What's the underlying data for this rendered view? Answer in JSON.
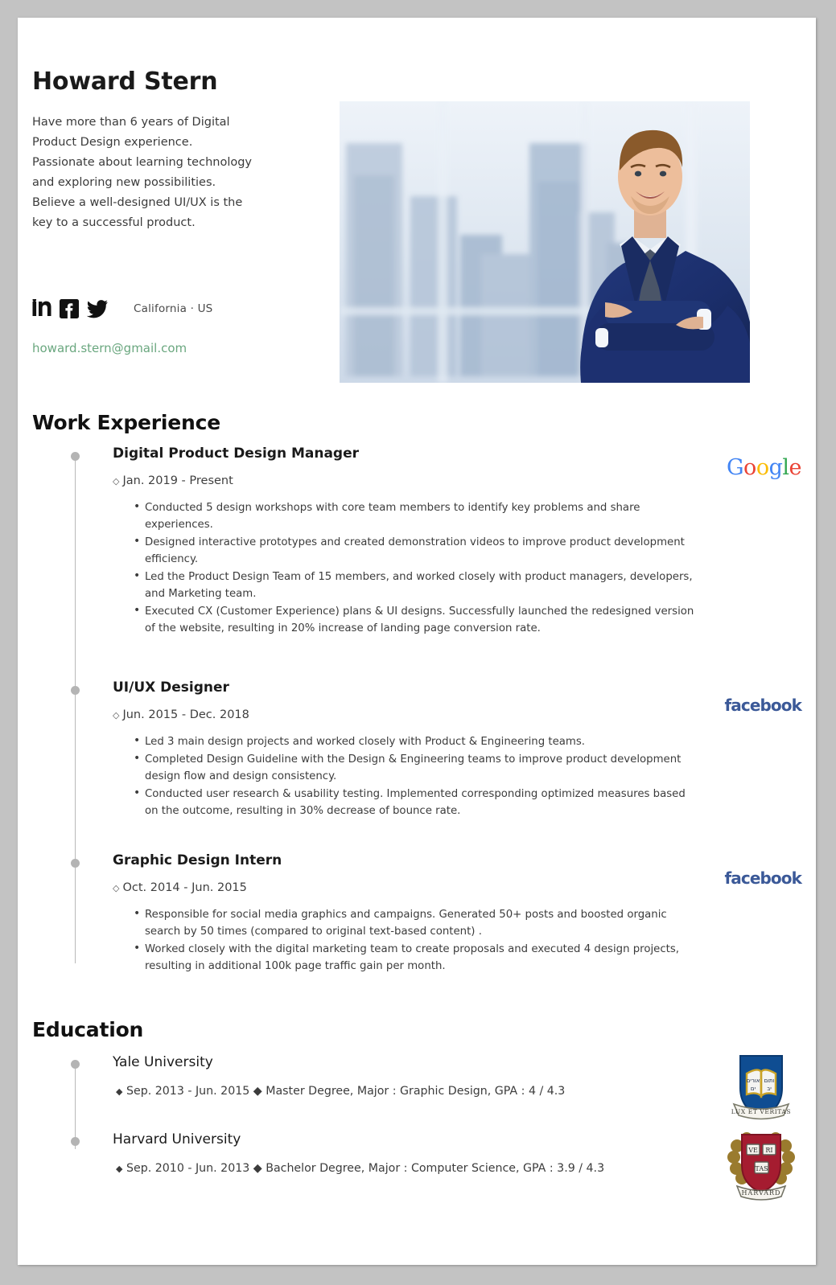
{
  "profile": {
    "name": "Howard Stern",
    "summary_lines": [
      "Have more than 6 years of Digital",
      "Product Design experience.",
      "Passionate about learning technology",
      "and exploring new possibilities.",
      "Believe a well-designed UI/UX is the",
      "key to a successful product."
    ],
    "location": "California · US",
    "email": "howard.stern@gmail.com",
    "social": [
      {
        "name": "linkedin-icon",
        "label": "in"
      },
      {
        "name": "facebook-icon",
        "label": "f"
      },
      {
        "name": "twitter-icon",
        "label": "twitter"
      }
    ],
    "photo_alt": "Portrait of man in navy suit with arms crossed in front of city skyline"
  },
  "colors": {
    "email": "#6aa77f",
    "timeline": "#b4b4b4",
    "facebook": "#3b5998",
    "google_blue": "#4285F4",
    "google_red": "#EA4335",
    "google_yellow": "#FBBC05",
    "google_green": "#34A853",
    "yale_navy": "#0f4d92",
    "harvard_crimson": "#a51c30",
    "page_background": "#c3c3c3"
  },
  "work": {
    "heading": "Work Experience",
    "jobs": [
      {
        "title": "Digital Product Design Manager",
        "date": "Jan. 2019 - Present",
        "logo": "google",
        "logo_text": "Google",
        "bullets": [
          "Conducted 5 design workshops with core team members to identify key problems and share experiences.",
          "Designed interactive prototypes and created demonstration videos to improve product development efficiency.",
          "Led the Product Design Team of 15 members, and worked closely with product managers, developers, and Marketing team.",
          "Executed CX (Customer Experience) plans & UI designs. Successfully launched the redesigned version of the website, resulting in 20% increase of landing page conversion rate."
        ]
      },
      {
        "title": "UI/UX Designer",
        "date": "Jun. 2015 - Dec. 2018",
        "logo": "facebook",
        "logo_text": "facebook",
        "bullets": [
          "Led 3 main design projects and worked closely with Product & Engineering teams.",
          "Completed Design Guideline with the Design & Engineering teams to improve product development design flow and design consistency.",
          "Conducted user research & usability testing. Implemented corresponding optimized measures based on the outcome, resulting in 30% decrease of bounce rate."
        ]
      },
      {
        "title": "Graphic Design Intern",
        "date": "Oct. 2014 - Jun. 2015",
        "logo": "facebook",
        "logo_text": "facebook",
        "bullets": [
          "Responsible for social media graphics and campaigns. Generated 50+ posts and boosted organic search by 50 times (compared to original text-based content) .",
          "Worked closely with the digital marketing team to create proposals and executed 4 design projects, resulting in additional 100k page traffic gain per month."
        ]
      }
    ]
  },
  "education": {
    "heading": "Education",
    "schools": [
      {
        "name": "Yale University",
        "detail": "Sep. 2013 - Jun. 2015 ◆ Master Degree, Major : Graphic Design, GPA : 4 / 4.3",
        "crest": "yale",
        "crest_motto": "LUX ET VERITAS"
      },
      {
        "name": "Harvard University",
        "detail": "Sep. 2010 - Jun. 2013 ◆ Bachelor Degree, Major : Computer Science, GPA : 3.9 / 4.3",
        "crest": "harvard",
        "crest_motto": "VERITAS"
      }
    ]
  }
}
